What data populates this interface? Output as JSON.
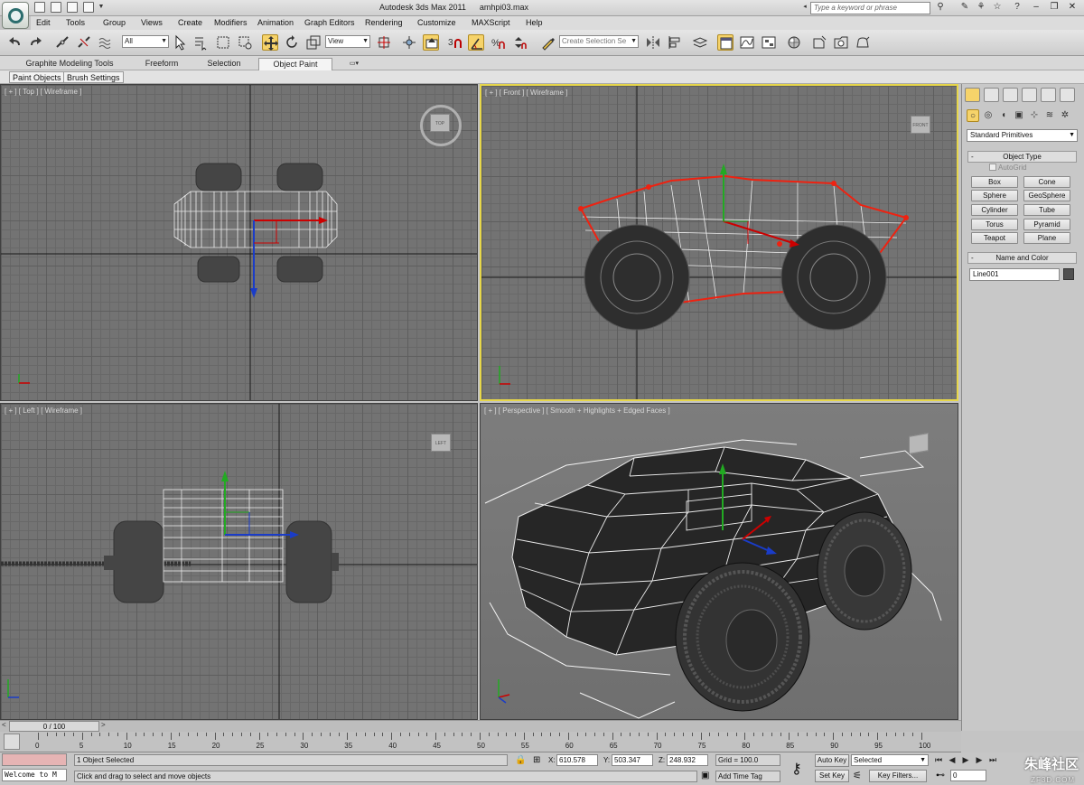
{
  "app": {
    "title": "Autodesk 3ds Max  2011",
    "file": "amhpi03.max",
    "search_placeholder": "Type a keyword or phrase"
  },
  "menu": [
    "Edit",
    "Tools",
    "Group",
    "Views",
    "Create",
    "Modifiers",
    "Animation",
    "Graph Editors",
    "Rendering",
    "Customize",
    "MAXScript",
    "Help"
  ],
  "toolbar": {
    "selection_filter": "All",
    "ref_coord": "View",
    "selection_set_placeholder": "Create Selection Se"
  },
  "ribbon": {
    "tabs": [
      "Graphite Modeling Tools",
      "Freeform",
      "Selection",
      "Object Paint"
    ],
    "active": "Object Paint",
    "sub_tabs": [
      "Paint Objects",
      "Brush Settings"
    ]
  },
  "viewports": {
    "top": {
      "label": "[ + ] [ Top ] [ Wireframe ]",
      "cube": "TOP"
    },
    "front": {
      "label": "[ + ] [ Front ] [ Wireframe ]",
      "cube": "FRONT"
    },
    "left": {
      "label": "[ + ] [ Left ] [ Wireframe ]",
      "cube": "LEFT"
    },
    "perspective": {
      "label": "[ + ] [ Perspective ] [ Smooth + Highlights + Edged Faces ]"
    }
  },
  "command_panel": {
    "category": "Standard Primitives",
    "object_type_title": "Object Type",
    "autogrid": "AutoGrid",
    "buttons": [
      "Box",
      "Cone",
      "Sphere",
      "GeoSphere",
      "Cylinder",
      "Tube",
      "Torus",
      "Pyramid",
      "Teapot",
      "Plane"
    ],
    "name_color_title": "Name and Color",
    "object_name": "Line001",
    "object_color": "#505050"
  },
  "timeline": {
    "frame_display": "0 / 100",
    "ticks": [
      "0",
      "5",
      "10",
      "15",
      "20",
      "25",
      "30",
      "35",
      "40",
      "45",
      "50",
      "55",
      "60",
      "65",
      "70",
      "75",
      "80",
      "85",
      "90",
      "95",
      "100"
    ]
  },
  "status": {
    "maxscript": "Welcome to M",
    "selection": "1 Object Selected",
    "prompt": "Click and drag to select and move objects",
    "x_label": "X:",
    "x": "610.578",
    "y_label": "Y:",
    "y": "503.347",
    "z_label": "Z:",
    "z": "248.932",
    "grid": "Grid = 100.0",
    "add_time_tag": "Add Time Tag",
    "auto_key": "Auto Key",
    "set_key": "Set Key",
    "key_mode": "Selected",
    "key_filters": "Key Filters...",
    "frame": "0"
  },
  "watermark": {
    "cn": "朱峰社区",
    "url": "ZF3D.COM"
  }
}
